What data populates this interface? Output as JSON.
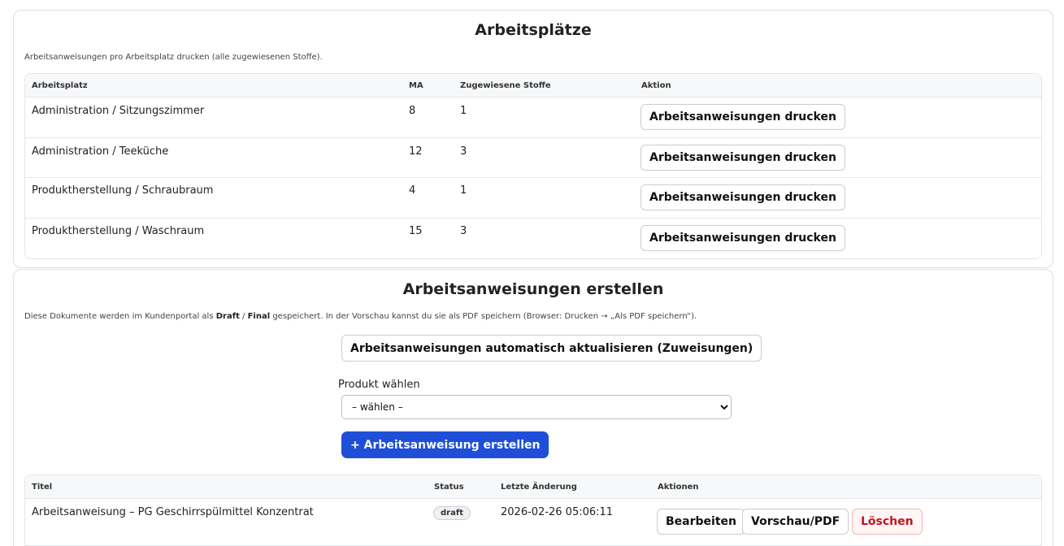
{
  "workplaces": {
    "title": "Arbeitsplätze",
    "note": "Arbeitsanweisungen pro Arbeitsplatz drucken (alle zugewiesenen Stoffe).",
    "headers": {
      "workplace": "Arbeitsplatz",
      "ma": "MA",
      "substances": "Zugewiesene Stoffe",
      "action": "Aktion"
    },
    "rows": [
      {
        "workplace": "Administration / Sitzungszimmer",
        "ma": "8",
        "substances": "1",
        "action": "Arbeitsanweisungen drucken"
      },
      {
        "workplace": "Administration / Teeküche",
        "ma": "12",
        "substances": "3",
        "action": "Arbeitsanweisungen drucken"
      },
      {
        "workplace": "Produktherstellung / Schraubraum",
        "ma": "4",
        "substances": "1",
        "action": "Arbeitsanweisungen drucken"
      },
      {
        "workplace": "Produktherstellung / Waschraum",
        "ma": "15",
        "substances": "3",
        "action": "Arbeitsanweisungen drucken"
      }
    ]
  },
  "create": {
    "title": "Arbeitsanweisungen erstellen",
    "note_pre": "Diese Dokumente werden im Kundenportal als ",
    "note_draft": "Draft",
    "note_sep": " / ",
    "note_final": "Final",
    "note_post": " gespeichert. In der Vorschau kannst du sie als PDF speichern (Browser: Drucken → „Als PDF speichern“).",
    "auto_update_button": "Arbeitsanweisungen automatisch aktualisieren (Zuweisungen)",
    "product_label": "Produkt wählen",
    "product_selected": "– wählen –",
    "create_button": "+ Arbeitsanweisung erstellen",
    "headers": {
      "title": "Titel",
      "status": "Status",
      "changed": "Letzte Änderung",
      "actions": "Aktionen"
    },
    "rows": [
      {
        "title": "Arbeitsanweisung – PG Geschirrspülmittel Konzentrat",
        "status": "draft",
        "changed": "2026-02-26 05:06:11",
        "edit": "Bearbeiten",
        "preview": "Vorschau/PDF",
        "delete": "Löschen"
      }
    ]
  },
  "colors": {
    "primary": "#1f4fd8",
    "danger": "#c0141c",
    "border": "#dcdfe3"
  }
}
